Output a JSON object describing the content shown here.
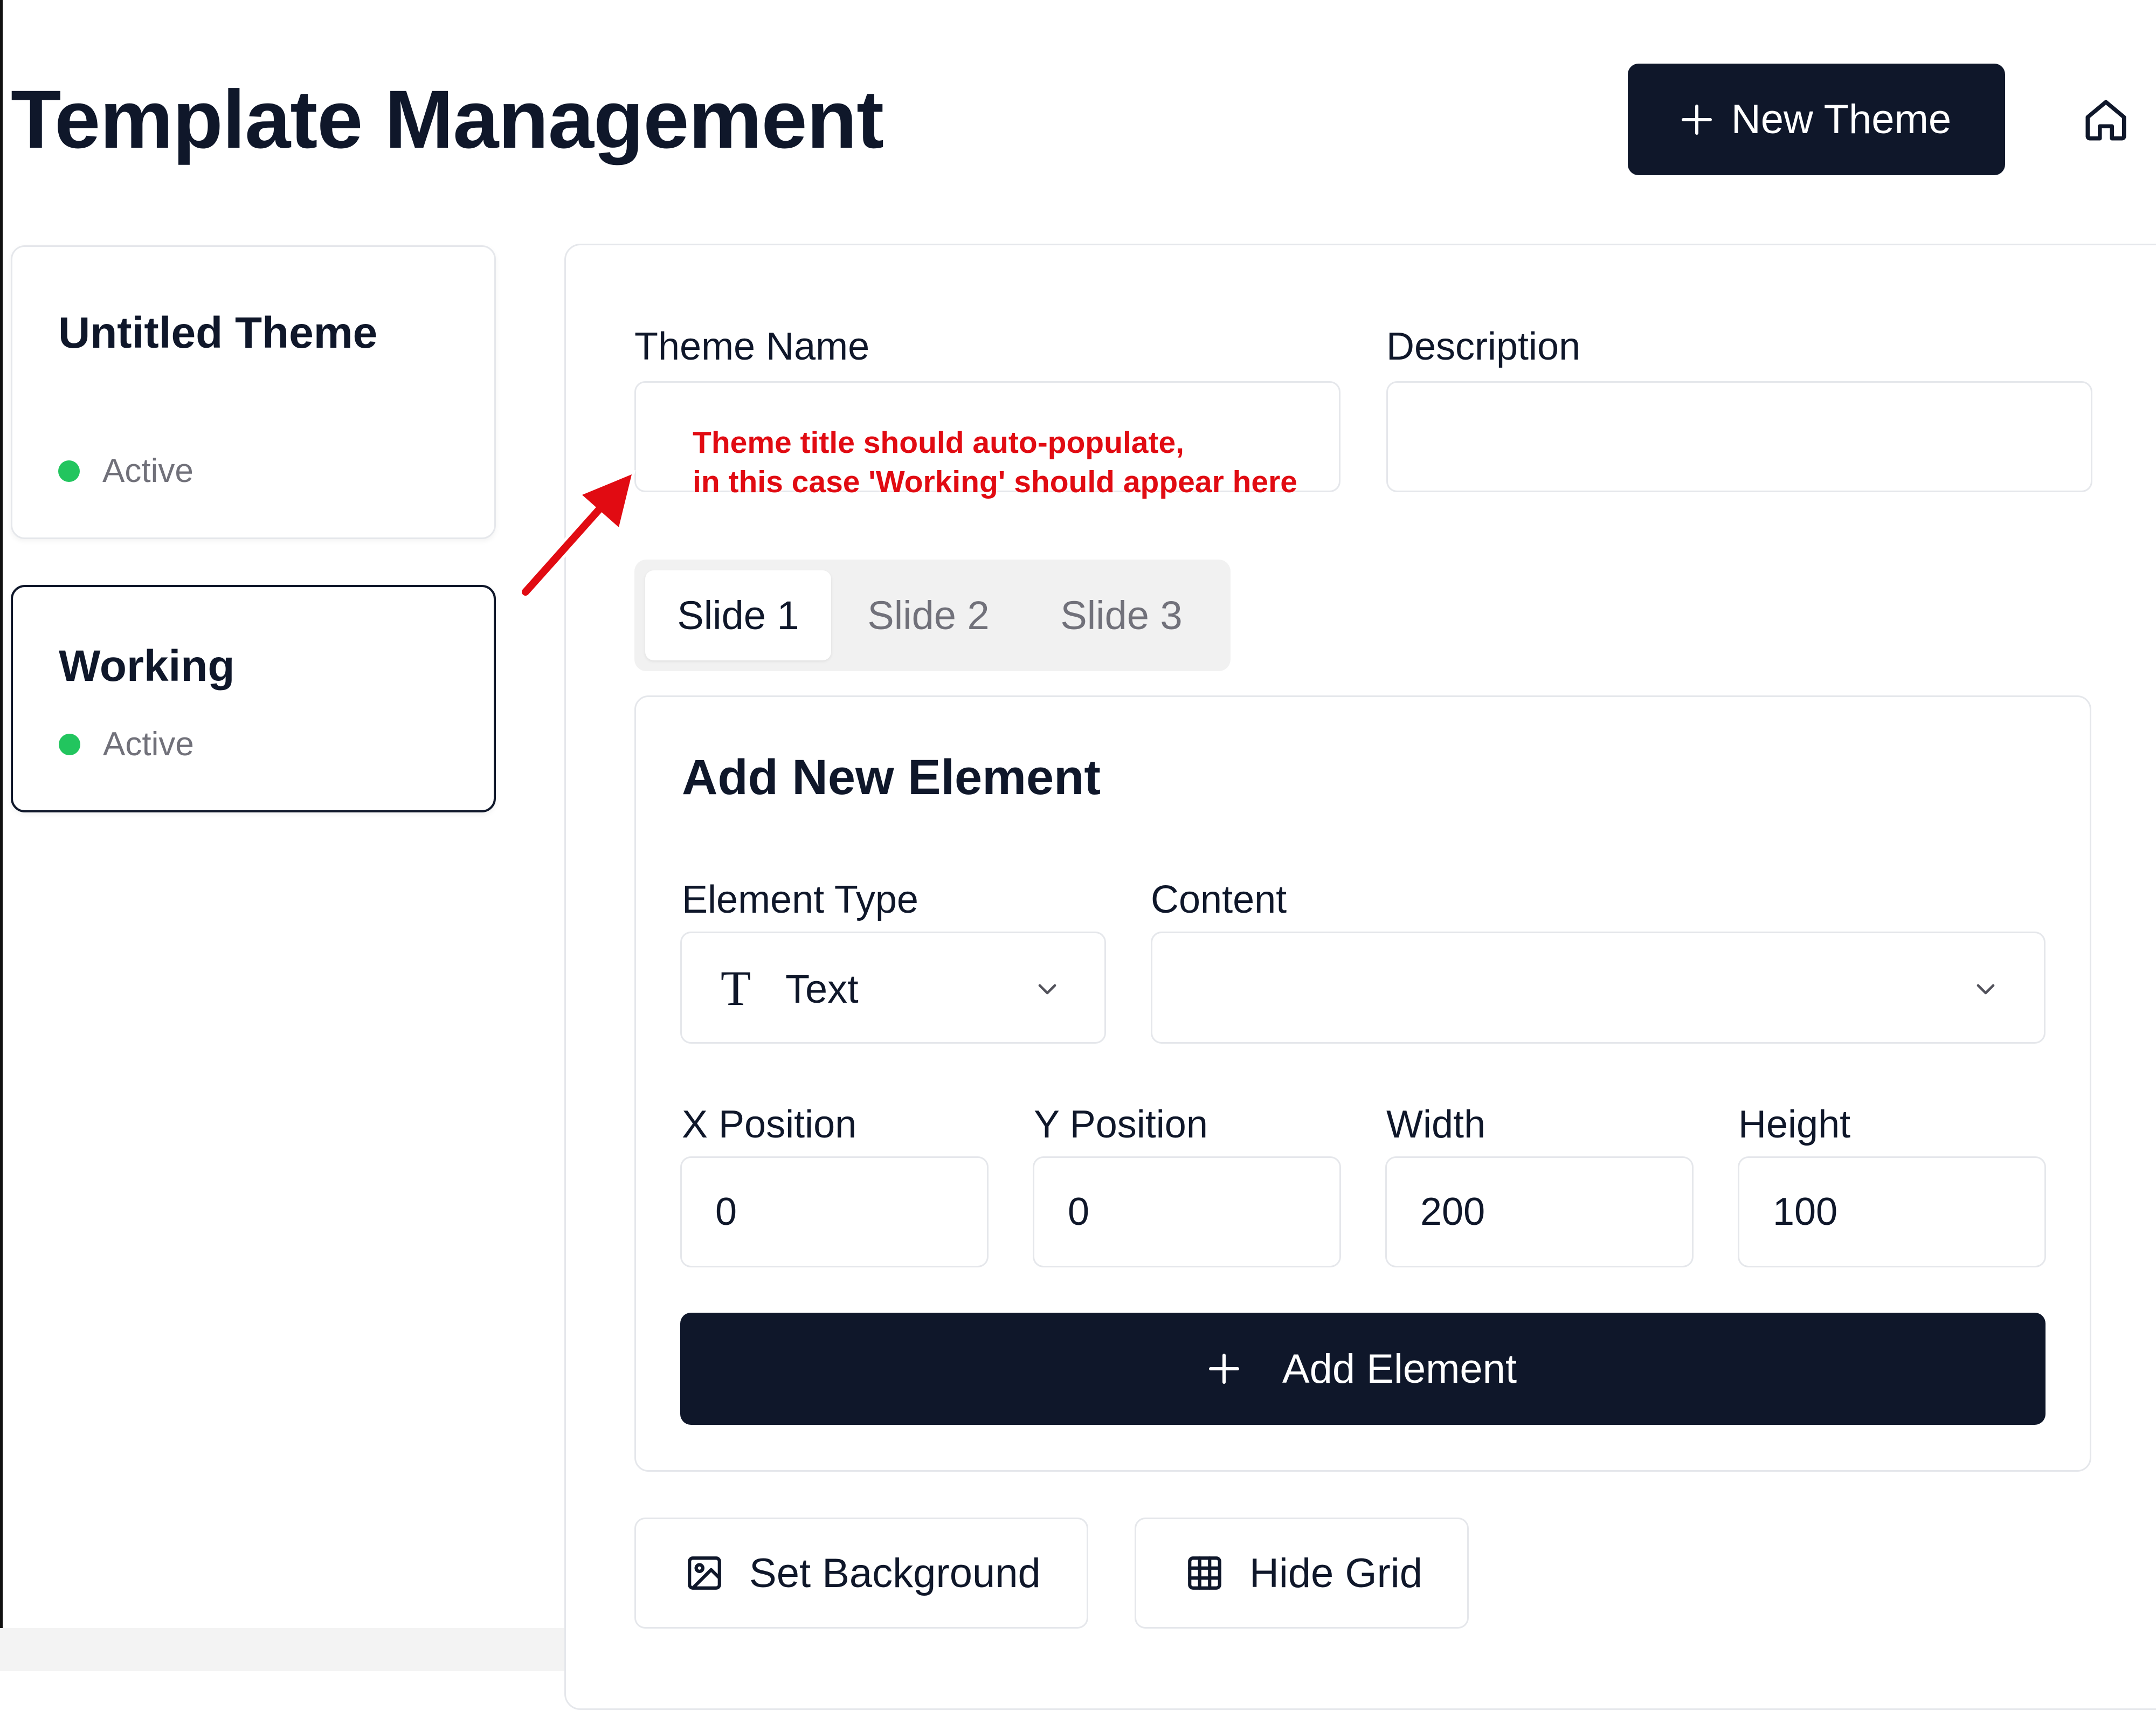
{
  "header": {
    "title": "Template Management",
    "new_theme_label": "New Theme",
    "home_icon": "home-icon"
  },
  "sidebar": {
    "themes": [
      {
        "name": "Untitled Theme",
        "status": "Active",
        "status_color": "#22c55e"
      },
      {
        "name": "Working",
        "status": "Active",
        "status_color": "#22c55e",
        "selected": true
      }
    ]
  },
  "form": {
    "theme_name_label": "Theme Name",
    "theme_name_value": "",
    "description_label": "Description",
    "description_value": ""
  },
  "annotation": {
    "line1": "Theme title should auto-populate,",
    "line2": "in this case 'Working' should appear here",
    "color": "#e10b12"
  },
  "tabs": [
    {
      "label": "Slide 1",
      "active": true
    },
    {
      "label": "Slide 2",
      "active": false
    },
    {
      "label": "Slide 3",
      "active": false
    }
  ],
  "element_form": {
    "title": "Add New Element",
    "type_label": "Element Type",
    "type_value": "Text",
    "content_label": "Content",
    "content_value": "",
    "x_label": "X Position",
    "x_value": "0",
    "y_label": "Y Position",
    "y_value": "0",
    "width_label": "Width",
    "width_value": "200",
    "height_label": "Height",
    "height_value": "100",
    "add_label": "Add Element"
  },
  "actions": {
    "set_background_label": "Set Background",
    "hide_grid_label": "Hide Grid"
  },
  "colors": {
    "primary": "#0f172a",
    "border": "#e5e7eb",
    "muted": "#71717a",
    "active_dot": "#22c55e"
  }
}
